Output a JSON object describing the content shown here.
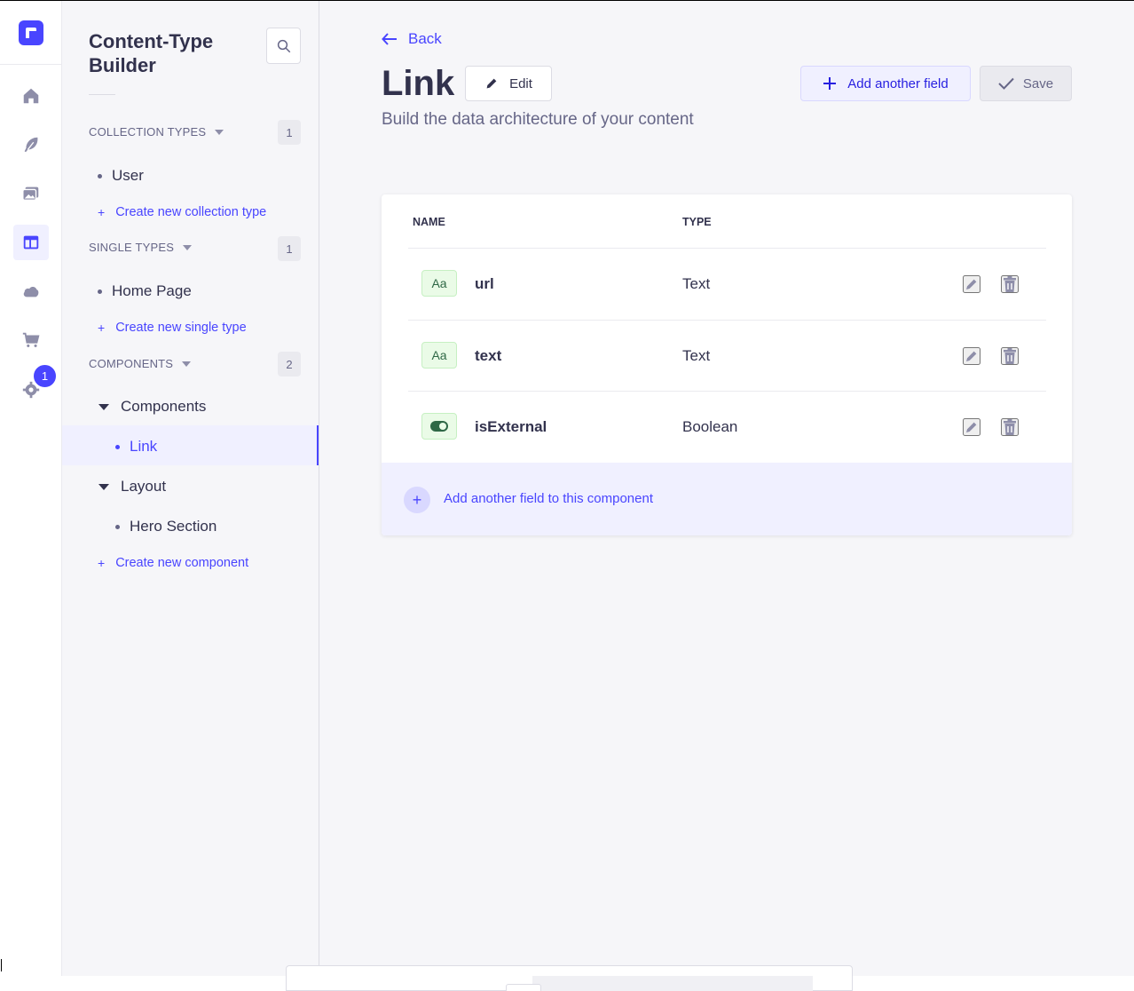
{
  "colors": {
    "primary": "#4945ff",
    "text": "#32324d",
    "muted": "#666687",
    "success_bg": "#eafbe7",
    "success_fg": "#2f6846"
  },
  "rail": {
    "items": [
      {
        "icon": "home-icon"
      },
      {
        "icon": "feather-icon"
      },
      {
        "icon": "media-library-icon"
      },
      {
        "icon": "layout-icon",
        "active": true
      },
      {
        "icon": "cloud-icon"
      },
      {
        "icon": "shopping-cart-icon"
      },
      {
        "icon": "gear-icon"
      }
    ],
    "settings_badge": "1"
  },
  "subnav": {
    "title": "Content-Type Builder",
    "collection_types": {
      "label": "COLLECTION TYPES",
      "count": "1",
      "items": [
        "User"
      ],
      "create_label": "Create new collection type"
    },
    "single_types": {
      "label": "SINGLE TYPES",
      "count": "1",
      "items": [
        "Home Page"
      ],
      "create_label": "Create new single type"
    },
    "components": {
      "label": "COMPONENTS",
      "count": "2",
      "categories": [
        {
          "name": "Components",
          "items": [
            "Link"
          ]
        },
        {
          "name": "Layout",
          "items": [
            "Hero Section"
          ]
        }
      ],
      "create_label": "Create new component"
    }
  },
  "header": {
    "back_label": "Back",
    "title": "Link",
    "edit_label": "Edit",
    "subtitle": "Build the data architecture of your content",
    "add_field_label": "Add another field",
    "save_label": "Save"
  },
  "table": {
    "columns": [
      "NAME",
      "TYPE"
    ],
    "rows": [
      {
        "icon": "text-field-icon",
        "icon_text": "Aa",
        "name": "url",
        "type": "Text"
      },
      {
        "icon": "text-field-icon",
        "icon_text": "Aa",
        "name": "text",
        "type": "Text"
      },
      {
        "icon": "boolean-field-icon",
        "icon_text": "",
        "name": "isExternal",
        "type": "Boolean"
      }
    ],
    "footer_label": "Add another field to this component"
  }
}
